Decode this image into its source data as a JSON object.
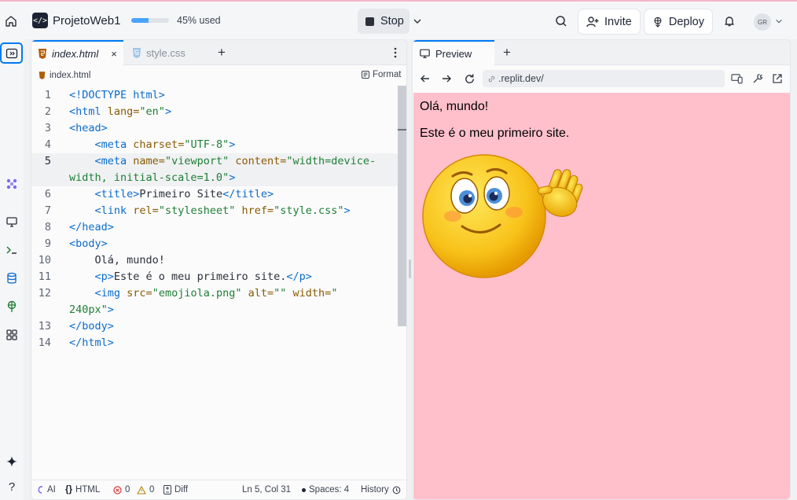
{
  "topbar": {
    "project_name": "ProjetoWeb1",
    "usage_fraction": 0.45,
    "usage_text": "45% used",
    "stop_label": "Stop",
    "invite_label": "Invite",
    "deploy_label": "Deploy",
    "avatar_initials": "GR"
  },
  "editor": {
    "tabs": [
      {
        "label": "index.html",
        "active": true
      },
      {
        "label": "style.css",
        "active": false
      }
    ],
    "breadcrumb": "index.html",
    "format_label": "Format",
    "lines": [
      {
        "n": "1",
        "html": "<span class='kw'>&lt;!DOCTYPE html&gt;</span>"
      },
      {
        "n": "2",
        "html": "<span class='kw'>&lt;html</span> <span class='at'>lang=</span><span class='st'>\"en\"</span><span class='kw'>&gt;</span>"
      },
      {
        "n": "3",
        "html": "<span class='kw'>&lt;head&gt;</span>"
      },
      {
        "n": "4",
        "html": "    <span class='kw'>&lt;meta</span> <span class='at'>charset=</span><span class='st'>\"UTF-8\"</span><span class='kw'>&gt;</span>"
      },
      {
        "n": "5",
        "html": "    <span class='kw'>&lt;meta</span> <span class='at'>name=</span><span class='st'>\"viewport\"</span> <span class='at'>content=</span><span class='st'>\"width=device-</span>",
        "hl": true
      },
      {
        "n": "",
        "html": "<span class='st'>width, initial-scale=1.0\"</span><span class='kw'>&gt;</span>",
        "hl": true
      },
      {
        "n": "6",
        "html": "    <span class='kw'>&lt;title&gt;</span><span class='pl'>Primeiro Site</span><span class='kw'>&lt;/title&gt;</span>"
      },
      {
        "n": "7",
        "html": "    <span class='kw'>&lt;link</span> <span class='at'>rel=</span><span class='st'>\"stylesheet\"</span> <span class='at'>href=</span><span class='st'>\"style.css\"</span><span class='kw'>&gt;</span>"
      },
      {
        "n": "8",
        "html": "<span class='kw'>&lt;/head&gt;</span>"
      },
      {
        "n": "9",
        "html": "<span class='kw'>&lt;body&gt;</span>"
      },
      {
        "n": "10",
        "html": "    <span class='pl'>Olá, mundo!</span>"
      },
      {
        "n": "11",
        "html": "    <span class='kw'>&lt;p&gt;</span><span class='pl'>Este é o meu primeiro site.</span><span class='kw'>&lt;/p&gt;</span>"
      },
      {
        "n": "12",
        "html": "    <span class='kw'>&lt;img</span> <span class='at'>src=</span><span class='st'>\"emojiola.png\"</span> <span class='at'>alt=</span><span class='st'>\"\"</span> <span class='at'>width=</span><span class='st'>\"</span>"
      },
      {
        "n": "",
        "html": "<span class='st'>240px\"</span><span class='kw'>&gt;</span>"
      },
      {
        "n": "13",
        "html": "<span class='kw'>&lt;/body&gt;</span>"
      },
      {
        "n": "14",
        "html": "<span class='kw'>&lt;/html&gt;</span>"
      }
    ],
    "status": {
      "ai": "AI",
      "lang": "HTML",
      "errors": "0",
      "warnings": "0",
      "diff": "Diff",
      "cursor": "Ln 5, Col 31",
      "spaces": "Spaces: 4",
      "history": "History"
    }
  },
  "preview": {
    "tab_label": "Preview",
    "url": ".replit.dev/",
    "heading_text": "Olá, mundo!",
    "paragraph_text": "Este é o meu primeiro site.",
    "background": "#ffc0cb"
  }
}
